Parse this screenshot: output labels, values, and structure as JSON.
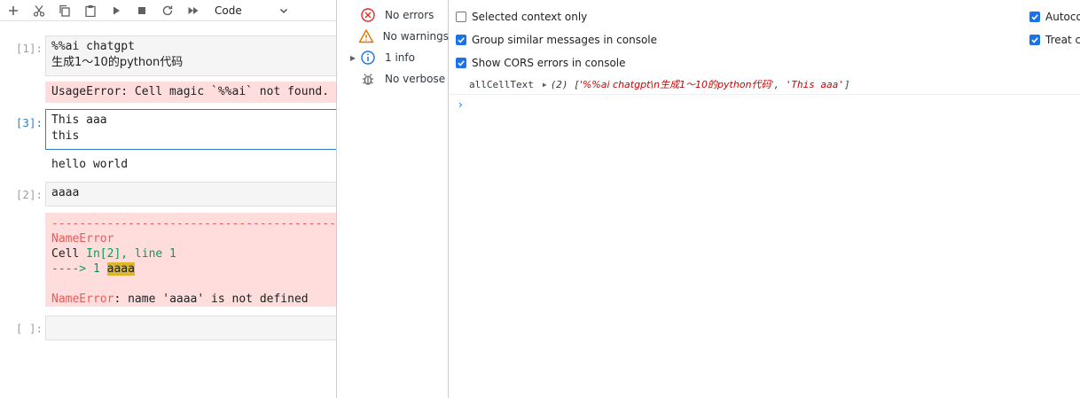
{
  "toolbar": {
    "cell_type": "Code"
  },
  "cells": [
    {
      "prompt": "[1]:",
      "lines": [
        "%%ai chatgpt",
        "生成1～10的python代码"
      ],
      "error_line": "UsageError: Cell magic `%%ai` not found."
    },
    {
      "prompt": "[3]:",
      "lines": [
        "This aaa",
        "this"
      ],
      "output": "hello world"
    },
    {
      "prompt": "[2]:",
      "lines": [
        "aaaa"
      ],
      "traceback": {
        "dashes": "---------------------------------------------------------------------------",
        "name": "NameError",
        "cell_prefix": "Cell ",
        "cell_ref": "In[2], line 1",
        "arrow": "----> 1 ",
        "code": "aaaa",
        "message_name": "NameError",
        "message_rest": ": name 'aaaa' is not defined"
      }
    },
    {
      "prompt": "[ ]:",
      "lines": [
        ""
      ]
    }
  ],
  "devtools": {
    "sidebar": [
      {
        "label": "No errors",
        "icon": "error-circle-icon",
        "color": "#d93025"
      },
      {
        "label": "No warnings",
        "icon": "warning-triangle-icon",
        "color": "#e37400"
      },
      {
        "label": "1 info",
        "icon": "info-circle-icon",
        "color": "#1a73e8"
      },
      {
        "label": "No verbose",
        "icon": "bug-icon",
        "color": "#5f6368"
      }
    ],
    "settings": {
      "selected_context": "Selected context only",
      "group_similar": "Group similar messages in console",
      "cors_errors": "Show CORS errors in console",
      "autocomplete": "Autoco",
      "treat": "Treat co"
    },
    "log": {
      "key": "allCellText",
      "count": "(2)",
      "open": "[",
      "item1": "'%%ai chatgpt\\n生成1～10的python代码'",
      "sep": ", ",
      "item2": "'This aaa'",
      "close": "]"
    },
    "prompt_symbol": "›",
    "accent": "#1a73e8"
  }
}
